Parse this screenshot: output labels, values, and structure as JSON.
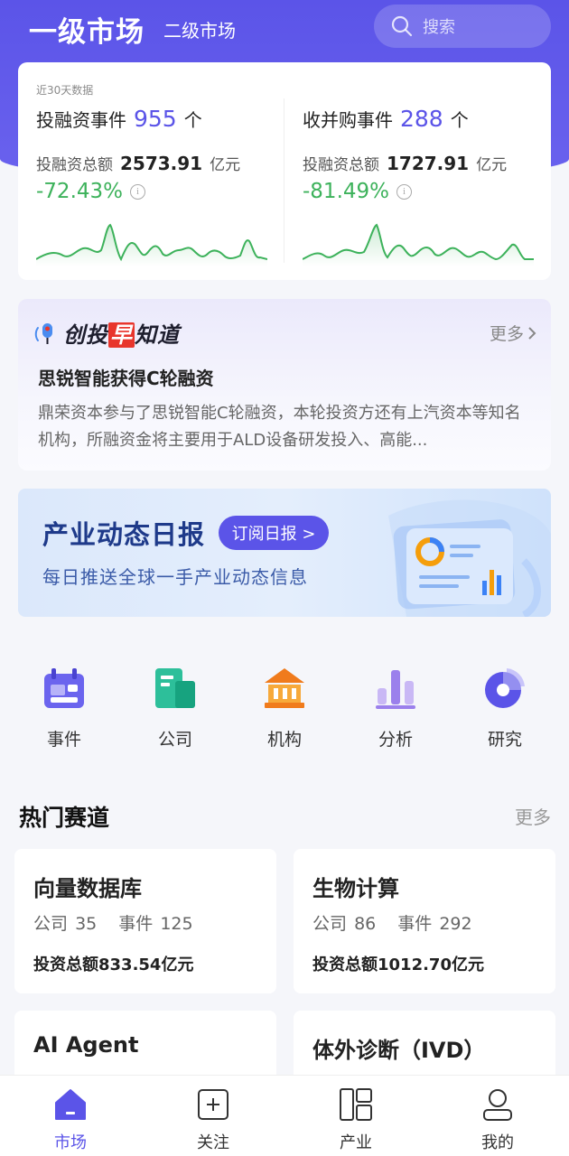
{
  "header": {
    "tab_primary": "一级市场",
    "tab_secondary": "二级市场",
    "search_placeholder": "搜索"
  },
  "stats": {
    "note": "近30天数据",
    "left": {
      "title": "投融资事件",
      "count": "955",
      "unit": "个",
      "amount_label": "投融资总额",
      "amount": "2573.91",
      "amount_unit": "亿元",
      "change": "-72.43%"
    },
    "right": {
      "title": "收并购事件",
      "count": "288",
      "unit": "个",
      "amount_label": "投融资总额",
      "amount": "1727.91",
      "amount_unit": "亿元",
      "change": "-81.49%"
    },
    "color_accent": "#5b54e8",
    "color_down": "#3db25b"
  },
  "news": {
    "brand_pre": "创投",
    "brand_hl": "早",
    "brand_post": "知道",
    "more": "更多",
    "title": "思锐智能获得C轮融资",
    "body": "鼎荣资本参与了思锐智能C轮融资，本轮投资方还有上汽资本等知名机构，所融资金将主要用于ALD设备研发投入、高能..."
  },
  "banner": {
    "title": "产业动态日报",
    "button": "订阅日报 >",
    "subtitle": "每日推送全球一手产业动态信息"
  },
  "quick_links": [
    {
      "label": "事件",
      "icon": "calendar-icon"
    },
    {
      "label": "公司",
      "icon": "building-icon"
    },
    {
      "label": "机构",
      "icon": "institution-icon"
    },
    {
      "label": "分析",
      "icon": "bar-chart-icon"
    },
    {
      "label": "研究",
      "icon": "pie-chart-icon"
    }
  ],
  "hot_tracks": {
    "title": "热门赛道",
    "more": "更多",
    "company_label": "公司",
    "event_label": "事件",
    "items": [
      {
        "name": "向量数据库",
        "companies": "35",
        "events": "125",
        "total": "投资总额833.54亿元"
      },
      {
        "name": "生物计算",
        "companies": "86",
        "events": "292",
        "total": "投资总额1012.70亿元"
      },
      {
        "name": "AI Agent"
      },
      {
        "name": "体外诊断（IVD）"
      }
    ]
  },
  "bottom_nav": [
    {
      "label": "市场",
      "icon": "home-icon",
      "active": true
    },
    {
      "label": "关注",
      "icon": "plus-square-icon"
    },
    {
      "label": "产业",
      "icon": "layout-icon"
    },
    {
      "label": "我的",
      "icon": "user-icon"
    }
  ]
}
